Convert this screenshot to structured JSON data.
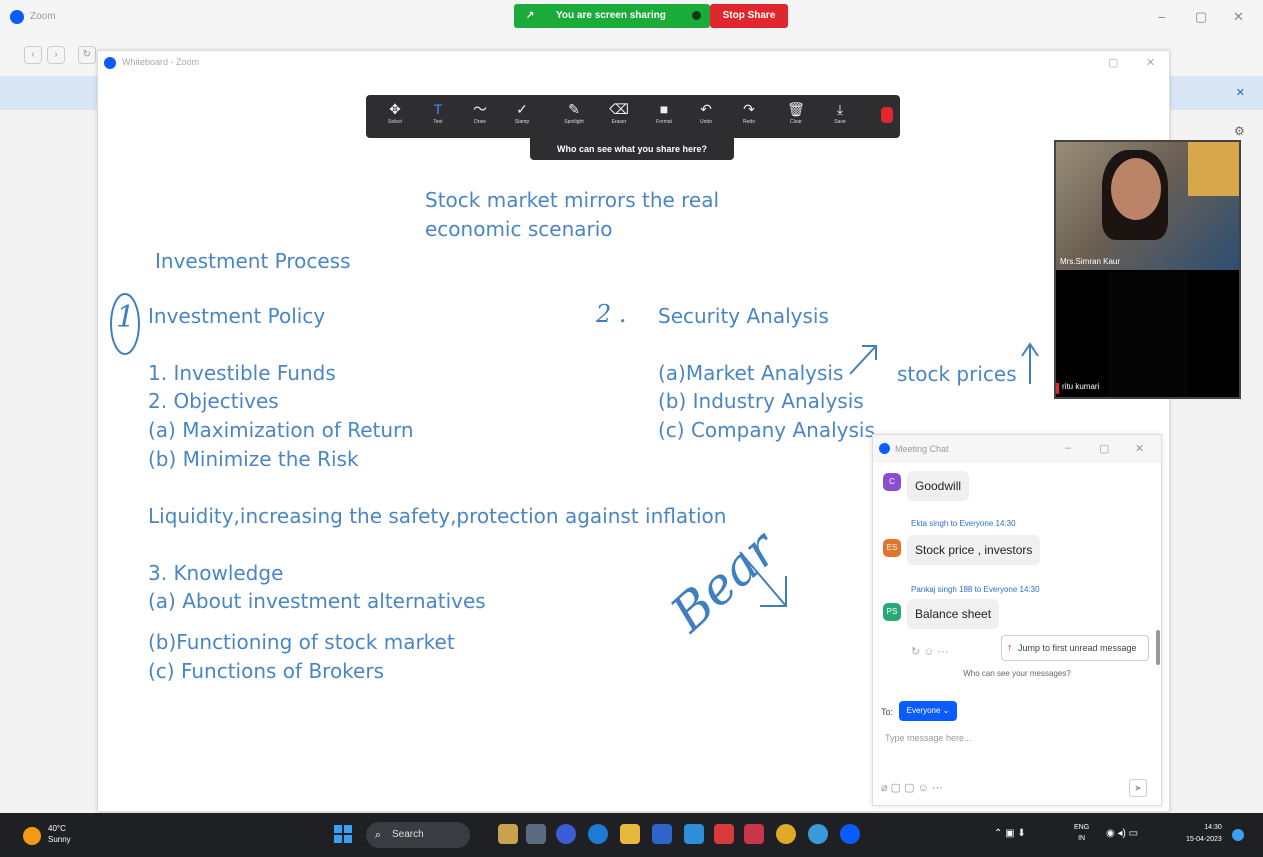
{
  "outer": {
    "app_title": "Zoom",
    "sharing_status": "You are screen sharing",
    "stop_share": "Stop Share"
  },
  "whiteboard": {
    "window_title": "Whiteboard - Zoom",
    "toolbar": [
      {
        "label": "Select",
        "icon": "move-icon",
        "glyph": "✥"
      },
      {
        "label": "Text",
        "icon": "text-icon",
        "glyph": "T",
        "active": true
      },
      {
        "label": "Draw",
        "icon": "draw-icon",
        "glyph": "〜"
      },
      {
        "label": "Stamp",
        "icon": "stamp-icon",
        "glyph": "✓"
      },
      {
        "label": "Spotlight",
        "icon": "spotlight-icon",
        "glyph": "✎"
      },
      {
        "label": "Eraser",
        "icon": "eraser-icon",
        "glyph": "⌫"
      },
      {
        "label": "Format",
        "icon": "format-icon",
        "glyph": "■"
      },
      {
        "label": "Undo",
        "icon": "undo-icon",
        "glyph": "↶"
      },
      {
        "label": "Redo",
        "icon": "redo-icon",
        "glyph": "↷"
      },
      {
        "label": "Clear",
        "icon": "trash-icon",
        "glyph": "🗑"
      },
      {
        "label": "Save",
        "icon": "save-icon",
        "glyph": "⤓"
      }
    ],
    "who_can_see": "Who can see what you share here?",
    "text": {
      "headline_1": "Stock market mirrors the real",
      "headline_2": "economic scenario",
      "investment_process": "Investment Process",
      "investment_policy": "Investment Policy",
      "item1": "1. Investible Funds",
      "item2": "2. Objectives",
      "item2a": "(a) Maximization of Return",
      "item2b": "(b) Minimize the Risk",
      "liquidity": "Liquidity,increasing the safety,protection against inflation",
      "item3": "3. Knowledge",
      "item3a": "(a) About investment alternatives",
      "item3b": "(b)Functioning of stock market",
      "item3c": "(c) Functions of Brokers",
      "security_analysis": "Security Analysis",
      "sec_a": "(a)Market Analysis",
      "sec_b": "(b) Industry Analysis",
      "sec_c": "(c) Company Analysis",
      "stock_prices": "stock prices",
      "hand_1": "1",
      "hand_2": "2 .",
      "hand_bear": "Bear"
    }
  },
  "video": {
    "participant_1": "Mrs.Simran Kaur",
    "participant_2": "ritu kumari"
  },
  "chat": {
    "title": "Meeting Chat",
    "messages": [
      {
        "avatar": "C",
        "avatar_color": "#8a4fd1",
        "sender": "",
        "text": "Goodwill"
      },
      {
        "avatar": "ES",
        "avatar_color": "#e0762b",
        "sender": "Ekta singh to Everyone 14:30",
        "text": "Stock price , investors"
      },
      {
        "avatar": "PS",
        "avatar_color": "#2aa876",
        "sender": "Pankaj singh 188 to Everyone 14:30",
        "text": "Balance sheet"
      }
    ],
    "jump_button": "Jump to first unread message",
    "who_can_see": "Who can see your messages?",
    "to_label": "To:",
    "to_value": "Everyone ⌄",
    "input_placeholder": "Type message here..."
  },
  "taskbar": {
    "temperature": "40°C",
    "weather": "Sunny",
    "search": "Search",
    "lang_1": "ENG",
    "lang_2": "IN",
    "time": "14:30",
    "date": "15-04-2023"
  }
}
